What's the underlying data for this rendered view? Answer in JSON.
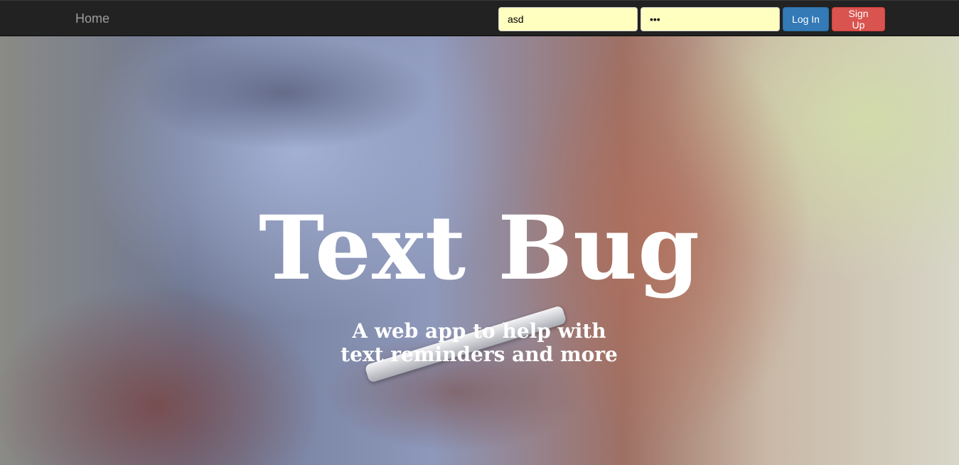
{
  "navbar": {
    "brand_label": "Home",
    "username_value": "asd",
    "password_value": "•••",
    "login_label": "Log In",
    "signup_label": "Sign Up"
  },
  "hero": {
    "title": "Text Bug",
    "subtitle": "A web app to help with text reminders and more"
  },
  "colors": {
    "navbar_bg": "#222222",
    "input_autofill_bg": "#ffffc0",
    "login_button": "#337ab7",
    "signup_button": "#d9534f",
    "hero_text": "#ffffff"
  }
}
